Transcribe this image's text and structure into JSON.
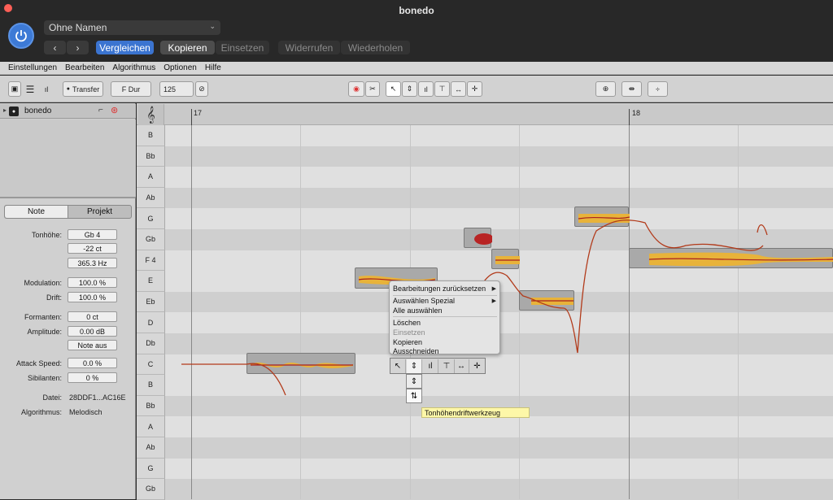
{
  "window": {
    "title": "bonedo"
  },
  "header": {
    "preset": "Ohne Namen",
    "compare": "Vergleichen",
    "copy": "Kopieren",
    "paste": "Einsetzen",
    "undo": "Widerrufen",
    "redo": "Wiederholen"
  },
  "menubar": [
    "Einstellungen",
    "Bearbeiten",
    "Algorithmus",
    "Optionen",
    "Hilfe"
  ],
  "toolbar": {
    "transfer": "Transfer",
    "key": "F Dur",
    "tempo": "125"
  },
  "track": {
    "name": "bonedo"
  },
  "inspector": {
    "tabs": [
      "Note",
      "Projekt"
    ],
    "pitch_label": "Tonhöhe:",
    "pitch_note": "Gb 4",
    "pitch_cents": "-22 ct",
    "pitch_hz": "365.3 Hz",
    "modulation_label": "Modulation:",
    "modulation": "100.0 %",
    "drift_label": "Drift:",
    "drift": "100.0 %",
    "formants_label": "Formanten:",
    "formants": "0 ct",
    "amplitude_label": "Amplitude:",
    "amplitude": "0.00 dB",
    "note_off": "Note aus",
    "attack_label": "Attack Speed:",
    "attack": "0.0 %",
    "sibilants_label": "Sibilanten:",
    "sibilants": "0 %",
    "file_label": "Datei:",
    "file": "28DDF1...AC16E",
    "algorithm_label": "Algorithmus:",
    "algorithm": "Melodisch"
  },
  "ruler": {
    "bar1": "17",
    "bar2": "18"
  },
  "keys": [
    "B",
    "Bb",
    "A",
    "Ab",
    "G",
    "Gb",
    "F 4",
    "E",
    "Eb",
    "D",
    "Db",
    "C",
    "B",
    "Bb",
    "A",
    "Ab",
    "G",
    "Gb"
  ],
  "context_menu": {
    "reset": "Bearbeitungen zurücksetzen",
    "select_special": "Auswählen Spezial",
    "select_all": "Alle auswählen",
    "delete": "Löschen",
    "paste": "Einsetzen",
    "copy": "Kopieren",
    "cut": "Ausschneiden"
  },
  "tooltip": "Tonhöhendriftwerkzeug",
  "colors": {
    "accent": "#3b74d0",
    "blob_hot": "#f5c542",
    "blob_core": "#a81f1f"
  }
}
